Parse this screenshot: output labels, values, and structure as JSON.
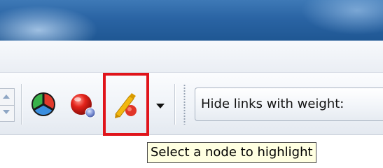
{
  "toolbar": {
    "buttons": [
      {
        "name": "color-wheel",
        "icon": "color-wheel-icon"
      },
      {
        "name": "red-node",
        "icon": "red-node-icon"
      },
      {
        "name": "highlight-node",
        "icon": "highlight-pen-icon",
        "selected": true
      }
    ],
    "dropdown_icon": "chevron-down-icon",
    "weight_filter_label": "Hide links with weight:"
  },
  "tooltip": {
    "text": "Select a node to highlight"
  },
  "colors": {
    "highlight_frame": "#e0141b",
    "tooltip_bg": "#ffffe1",
    "titlebar": "#2a64a4"
  }
}
